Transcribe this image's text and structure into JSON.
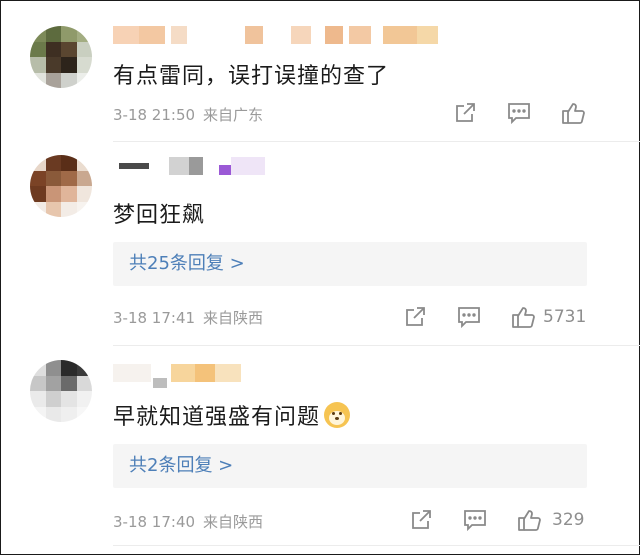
{
  "comments": [
    {
      "text": "有点雷同，误打误撞的查了",
      "date": "3-18 21:50",
      "location": "来自广东",
      "like_count": ""
    },
    {
      "text": "梦回狂飙",
      "replies_label": "共25条回复 >",
      "date": "3-18 17:41",
      "location": "来自陕西",
      "like_count": "5731"
    },
    {
      "text": "早就知道强盛有问题",
      "emoji": "doge-emoji",
      "replies_label": "共2条回复 >",
      "date": "3-18 17:40",
      "location": "来自陕西",
      "like_count": "329"
    }
  ],
  "icons": [
    "share-icon",
    "comment-icon",
    "like-icon"
  ],
  "colors": {
    "text": "#1b1b1b",
    "meta": "#9a9a9a",
    "link": "#4d7fb8",
    "reply_bg": "#f5f5f5",
    "icon": "#8a8a8a"
  }
}
